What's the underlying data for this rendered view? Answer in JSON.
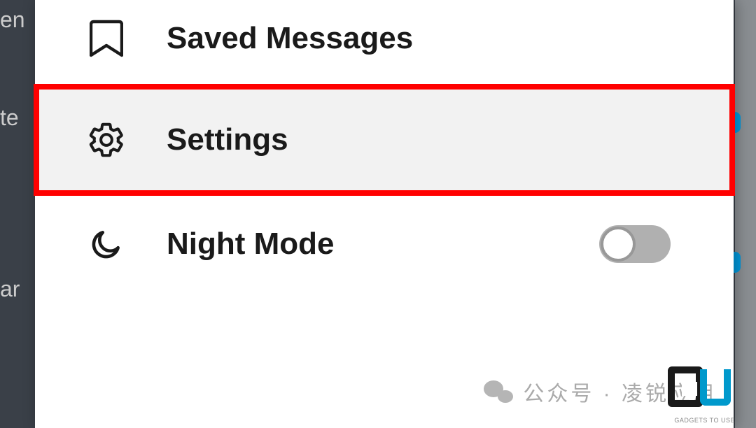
{
  "background": {
    "text1": "en",
    "text2": "te",
    "text3": "ar"
  },
  "menu": {
    "saved": {
      "label": "Saved Messages",
      "icon": "bookmark-icon"
    },
    "settings": {
      "label": "Settings",
      "icon": "gear-icon",
      "highlighted": true
    },
    "night": {
      "label": "Night Mode",
      "icon": "moon-icon",
      "toggle": false
    }
  },
  "watermark": {
    "text": "公众号 · 凌锐应用"
  },
  "logo": {
    "text": "GADGETS TO USE"
  },
  "colors": {
    "highlight_border": "#ff0000",
    "highlight_bg": "#f2f2f2",
    "toggle_off": "#b0b0b0"
  }
}
